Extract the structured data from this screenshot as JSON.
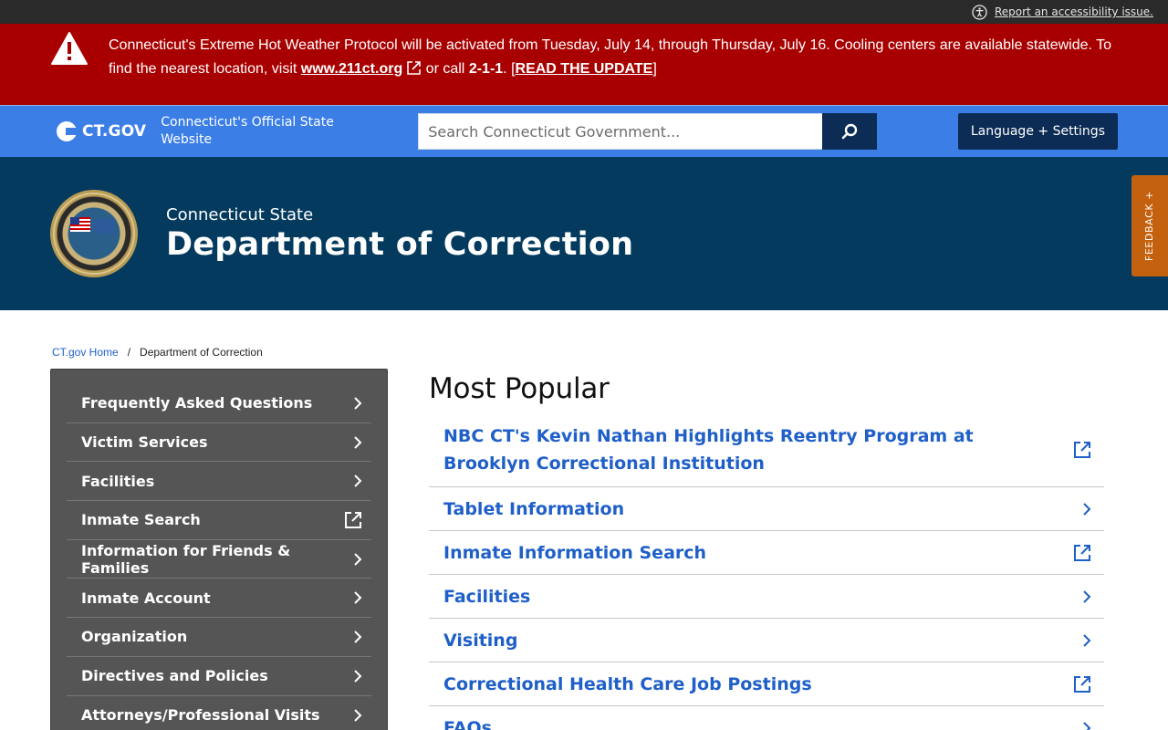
{
  "utility": {
    "accessibility_link": "Report an accessibility issue."
  },
  "alert": {
    "text_before": "Connecticut's Extreme Hot Weather Protocol will be activated from Tuesday, July 14, through Thursday, July 16. Cooling centers are available statewide. To find the nearest location, visit ",
    "link_text": "www.211ct.org",
    "text_middle": " or call ",
    "phone": "2-1-1",
    "text_after": ". [",
    "update_link": "READ THE UPDATE",
    "text_close": "]"
  },
  "header": {
    "brand": "CT.GOV",
    "tagline": "Connecticut's Official State Website",
    "search_placeholder": "Search Connecticut Government...",
    "language_button": "Language + Settings"
  },
  "agency": {
    "pre_title": "Connecticut State",
    "title": "Department of Correction",
    "feedback": "FEEDBACK +"
  },
  "breadcrumb": {
    "home": "CT.gov Home",
    "separator": "/",
    "current": "Department of Correction"
  },
  "sidenav": {
    "items": [
      {
        "label": "Frequently Asked Questions",
        "icon": "chevron-right-icon"
      },
      {
        "label": "Victim Services",
        "icon": "chevron-right-icon"
      },
      {
        "label": "Facilities",
        "icon": "chevron-right-icon"
      },
      {
        "label": "Inmate Search",
        "icon": "external-link-icon"
      },
      {
        "label": "Information for Friends & Families",
        "icon": "chevron-right-icon"
      },
      {
        "label": "Inmate Account",
        "icon": "chevron-right-icon"
      },
      {
        "label": "Organization",
        "icon": "chevron-right-icon"
      },
      {
        "label": "Directives and Policies",
        "icon": "chevron-right-icon"
      },
      {
        "label": "Attorneys/Professional Visits",
        "icon": "chevron-right-icon"
      }
    ]
  },
  "main": {
    "heading": "Most Popular",
    "items": [
      {
        "label": "NBC CT's Kevin Nathan Highlights Reentry Program at Brooklyn Correctional Institution",
        "icon": "external-link-icon"
      },
      {
        "label": "Tablet Information",
        "icon": "chevron-right-icon"
      },
      {
        "label": "Inmate Information Search",
        "icon": "external-link-icon"
      },
      {
        "label": "Facilities",
        "icon": "chevron-right-icon"
      },
      {
        "label": "Visiting",
        "icon": "chevron-right-icon"
      },
      {
        "label": "Correctional Health Care Job Postings",
        "icon": "external-link-icon"
      },
      {
        "label": "FAQs",
        "icon": "chevron-right-icon"
      }
    ]
  },
  "colors": {
    "alert_bg": "#a80000",
    "header_bg": "#3b7ee6",
    "agency_bg": "#033a5e",
    "nav_bg": "#555555",
    "link": "#1f5fc8",
    "feedback_bg": "#c4610e"
  }
}
